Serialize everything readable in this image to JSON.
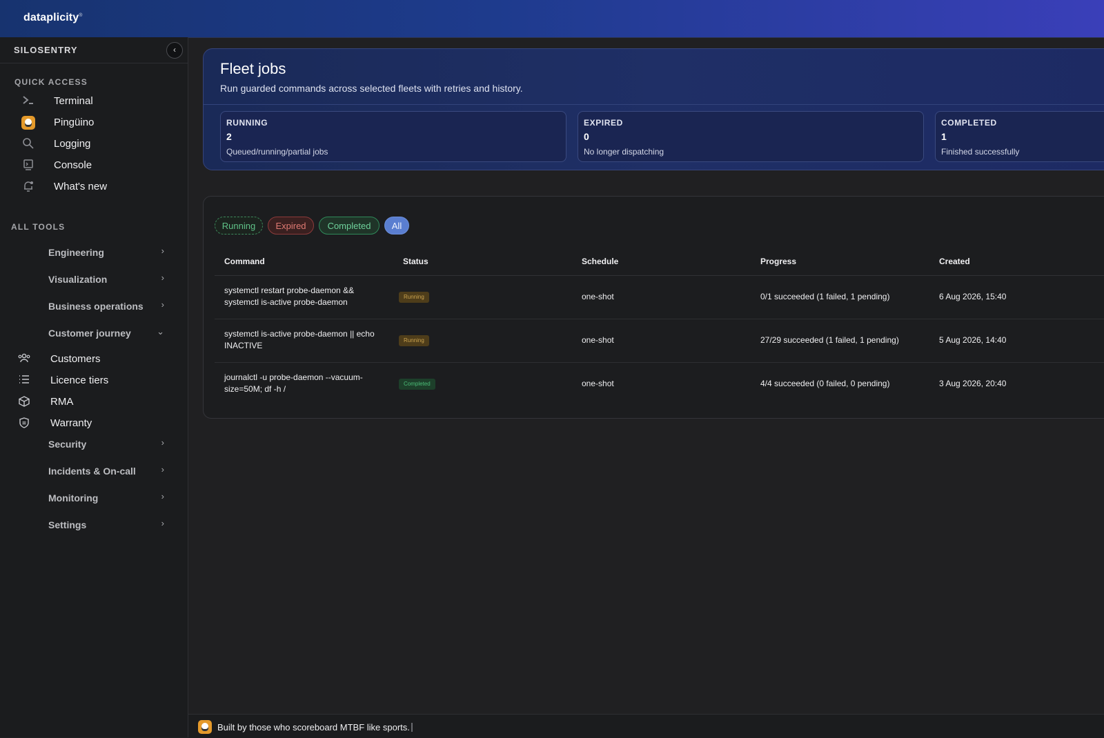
{
  "app": {
    "logo": "dataplicity",
    "logo_mark": "®"
  },
  "sidebar": {
    "org": "SILOSENTRY",
    "collapse_icon": "chevron-left-icon",
    "quick_access_label": "QUICK ACCESS",
    "quick_access": [
      {
        "label": "Terminal",
        "icon": "terminal-icon"
      },
      {
        "label": "Pingüino",
        "icon": "penguin-icon"
      },
      {
        "label": "Logging",
        "icon": "search-icon"
      },
      {
        "label": "Console",
        "icon": "monitor-icon"
      },
      {
        "label": "What's new",
        "icon": "bell-icon"
      }
    ],
    "all_tools_label": "ALL TOOLS",
    "tools": [
      {
        "label": "Engineering",
        "chevron": "›"
      },
      {
        "label": "Visualization",
        "chevron": "›"
      },
      {
        "label": "Business operations",
        "chevron": "›"
      },
      {
        "label": "Customer journey",
        "chevron": "⌄"
      }
    ],
    "customer_journey_items": [
      {
        "label": "Customers",
        "icon": "users-icon"
      },
      {
        "label": "Licence tiers",
        "icon": "list-icon"
      },
      {
        "label": "RMA",
        "icon": "box-icon"
      },
      {
        "label": "Warranty",
        "icon": "shield-icon"
      }
    ],
    "tools_bottom": [
      {
        "label": "Security",
        "chevron": "›"
      },
      {
        "label": "Incidents & On-call",
        "chevron": "›"
      },
      {
        "label": "Monitoring",
        "chevron": "›"
      },
      {
        "label": "Settings",
        "chevron": "›"
      }
    ]
  },
  "hero": {
    "title": "Fleet jobs",
    "subtitle": "Run guarded commands across selected fleets with retries and history.",
    "stats": [
      {
        "label": "RUNNING",
        "value": "2",
        "desc": "Queued/running/partial jobs"
      },
      {
        "label": "EXPIRED",
        "value": "0",
        "desc": "No longer dispatching"
      },
      {
        "label": "COMPLETED",
        "value": "1",
        "desc": "Finished successfully"
      }
    ]
  },
  "filters": {
    "running": "Running",
    "expired": "Expired",
    "completed": "Completed",
    "all": "All",
    "active": "All"
  },
  "table": {
    "headers": {
      "command": "Command",
      "status": "Status",
      "schedule": "Schedule",
      "progress": "Progress",
      "created": "Created"
    },
    "rows": [
      {
        "command": "systemctl restart probe-daemon && systemctl is-active probe-daemon",
        "status": "Running",
        "schedule": "one-shot",
        "progress": "0/1 succeeded (1 failed, 1 pending)",
        "created": "6 Aug 2026, 15:40"
      },
      {
        "command": "systemctl is-active probe-daemon || echo INACTIVE",
        "status": "Running",
        "schedule": "one-shot",
        "progress": "27/29 succeeded (1 failed, 1 pending)",
        "created": "5 Aug 2026, 14:40"
      },
      {
        "command": "journalctl -u probe-daemon --vacuum-size=50M; df -h /",
        "status": "Completed",
        "schedule": "one-shot",
        "progress": "4/4 succeeded (0 failed, 0 pending)",
        "created": "3 Aug 2026, 20:40"
      }
    ]
  },
  "footer": {
    "text": "Built by those who scoreboard MTBF like sports."
  },
  "colors": {
    "accent": "#1e3b8d",
    "running": "#c9a24e",
    "completed": "#4cbe78",
    "expired": "#e07a73"
  }
}
